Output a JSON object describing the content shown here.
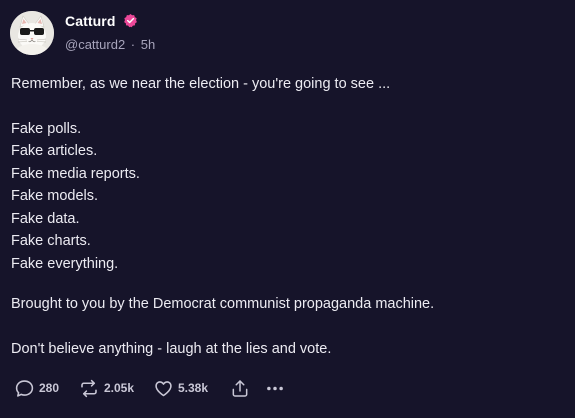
{
  "post": {
    "author": {
      "display_name": "Catturd",
      "handle": "@catturd2",
      "separator": "·",
      "time_ago": "5h",
      "verified_icon": "verified-badge-icon",
      "avatar_icon": "cat-avatar"
    },
    "body": {
      "intro": "Remember, as we near the election - you're going to see ...",
      "list": [
        "Fake polls.",
        "Fake articles.",
        "Fake media reports.",
        "Fake models.",
        "Fake data.",
        "Fake charts.",
        "Fake everything."
      ],
      "brought": "Brought to you by the Democrat communist propaganda machine.",
      "closing": "Don't believe anything - laugh at the lies and vote."
    },
    "actions": {
      "reply_count": "280",
      "repost_count": "2.05k",
      "like_count": "5.38k",
      "icons": [
        "reply-icon",
        "repost-icon",
        "like-icon",
        "share-icon",
        "more-icon"
      ]
    }
  },
  "colors": {
    "background": "#16142a",
    "text": "#ecebf2",
    "muted": "#a7a4bb",
    "verified": "#ec4899"
  }
}
